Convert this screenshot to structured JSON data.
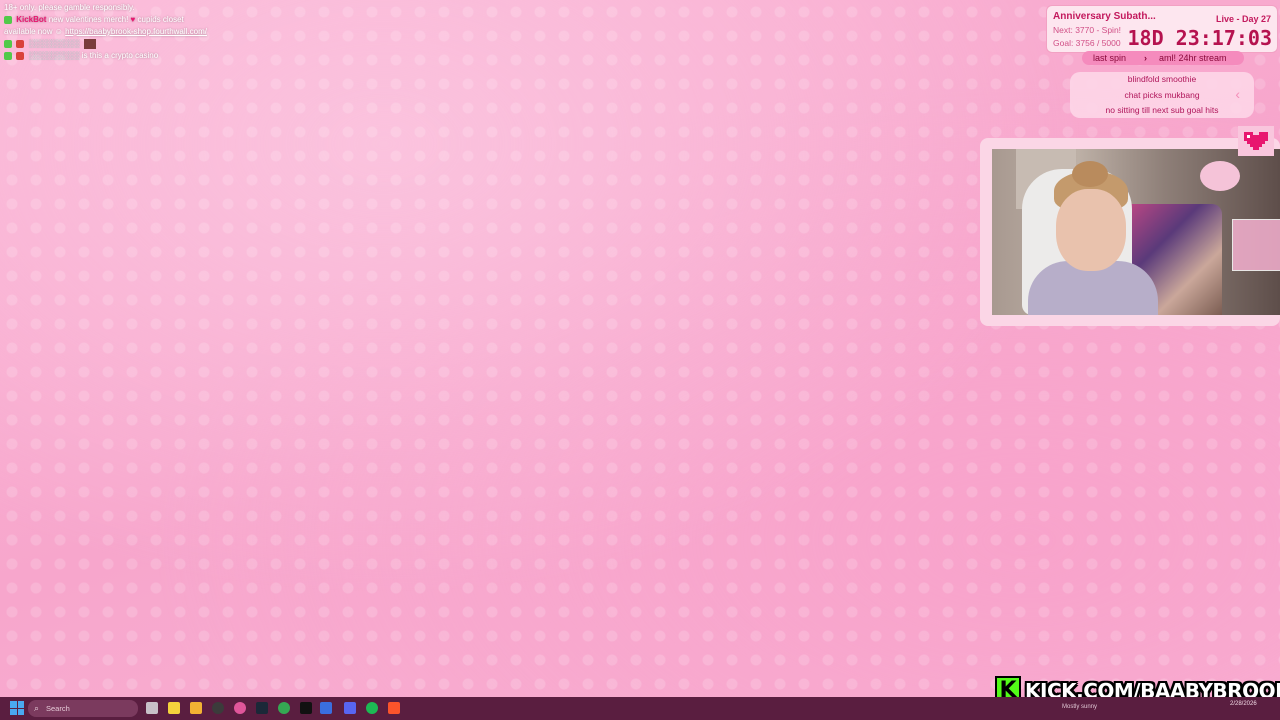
{
  "chat": {
    "line1": "18+ only. please gamble responsibly.",
    "bot_name": "KickBot",
    "bot_msg": "new valentines merch!",
    "bot_msg2": "cupids closet",
    "bot_msg3": "available now",
    "link": "https://baabybrook-shop.fourthwall.com/",
    "user_msg": "is this a crypto casino"
  },
  "subathon": {
    "title": "Anniversary Subath...",
    "live": "Live - Day 27",
    "next": "Next: 3770 - Spin!",
    "goal": "Goal: 3756 / 5000",
    "timer": "18D 23:17:03"
  },
  "last_spin": {
    "label": "last spin",
    "value": "aml! 24hr stream"
  },
  "spin_list": [
    "blindfold smoothie",
    "chat picks mukbang",
    "no sitting till next sub goal hits"
  ],
  "brand": {
    "logo": "K",
    "url": "KICK.COM/BAABYBROOK"
  },
  "taskbar": {
    "search_placeholder": "Search",
    "weather": "Mostly sunny",
    "date": "2/28/2026"
  },
  "colors": {
    "accent": "#e8166f",
    "panel_bg": "#fde6ef",
    "taskbar": "#5a1e40",
    "kick_green": "#53fc18"
  }
}
